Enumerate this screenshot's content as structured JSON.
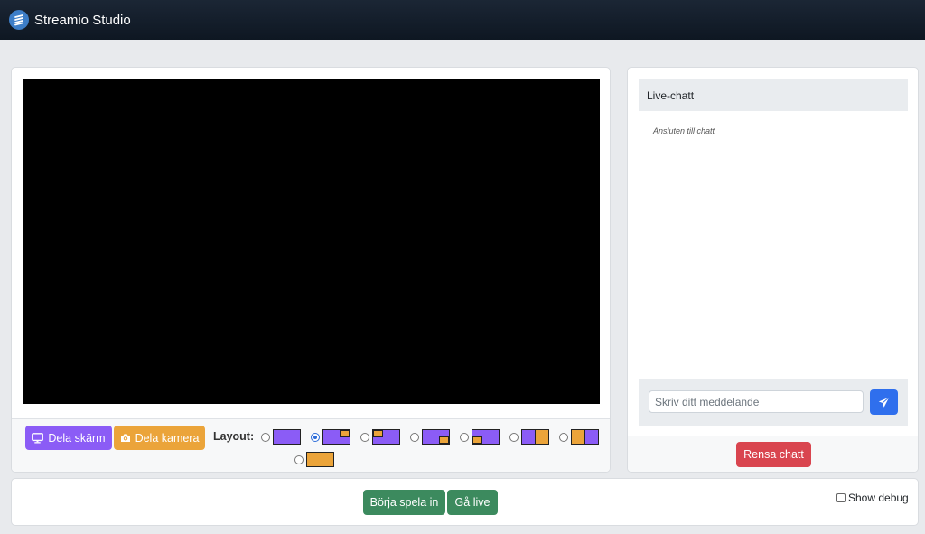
{
  "app": {
    "title": "Streamio Studio"
  },
  "colors": {
    "screen": "#8b5cf6",
    "camera": "#eba43a",
    "record": "#3c8a5e",
    "clear": "#d9454f",
    "send": "#2f6fed"
  },
  "controls": {
    "share_screen_label": "Dela skärm",
    "share_screen_icon": "monitor-icon",
    "share_camera_label": "Dela kamera",
    "share_camera_icon": "camera-icon",
    "layout_label": "Layout:",
    "layouts": [
      {
        "id": "screen-only",
        "selected": false
      },
      {
        "id": "camera-top-right",
        "selected": true
      },
      {
        "id": "camera-top-left",
        "selected": false
      },
      {
        "id": "camera-bottom-right",
        "selected": false
      },
      {
        "id": "camera-bottom-left",
        "selected": false
      },
      {
        "id": "split-screen-camera",
        "selected": false
      },
      {
        "id": "split-camera-screen",
        "selected": false
      },
      {
        "id": "camera-only",
        "selected": false
      }
    ]
  },
  "chat": {
    "title": "Live-chatt",
    "messages": [
      "Ansluten till chatt"
    ],
    "input_placeholder": "Skriv ditt meddelande",
    "input_value": "",
    "send_icon": "paper-plane-icon",
    "clear_label": "Rensa chatt"
  },
  "actions": {
    "record_label": "Börja spela in",
    "live_label": "Gå live",
    "debug_label": "Show debug",
    "debug_checked": false
  }
}
